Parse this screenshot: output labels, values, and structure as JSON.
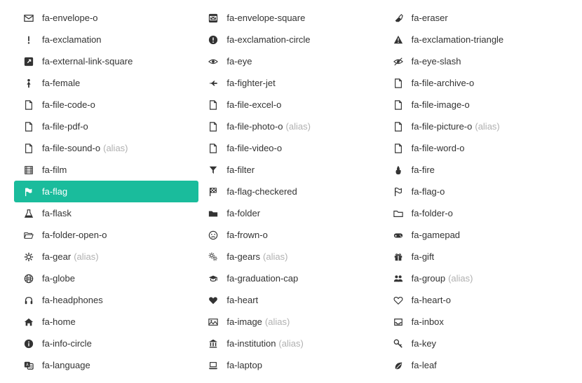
{
  "alias_text": "(alias)",
  "items": [
    {
      "name": "fa-envelope-o",
      "icon": "envelope-o",
      "alias": false,
      "active": false
    },
    {
      "name": "fa-envelope-square",
      "icon": "envelope-square",
      "alias": false,
      "active": false
    },
    {
      "name": "fa-eraser",
      "icon": "eraser",
      "alias": false,
      "active": false
    },
    {
      "name": "fa-exclamation",
      "icon": "exclamation",
      "alias": false,
      "active": false
    },
    {
      "name": "fa-exclamation-circle",
      "icon": "exclamation-circle",
      "alias": false,
      "active": false
    },
    {
      "name": "fa-exclamation-triangle",
      "icon": "exclamation-triangle",
      "alias": false,
      "active": false
    },
    {
      "name": "fa-external-link-square",
      "icon": "external-link-square",
      "alias": false,
      "active": false
    },
    {
      "name": "fa-eye",
      "icon": "eye",
      "alias": false,
      "active": false
    },
    {
      "name": "fa-eye-slash",
      "icon": "eye-slash",
      "alias": false,
      "active": false
    },
    {
      "name": "fa-female",
      "icon": "female",
      "alias": false,
      "active": false
    },
    {
      "name": "fa-fighter-jet",
      "icon": "fighter-jet",
      "alias": false,
      "active": false
    },
    {
      "name": "fa-file-archive-o",
      "icon": "file-archive-o",
      "alias": false,
      "active": false
    },
    {
      "name": "fa-file-code-o",
      "icon": "file-code-o",
      "alias": false,
      "active": false
    },
    {
      "name": "fa-file-excel-o",
      "icon": "file-excel-o",
      "alias": false,
      "active": false
    },
    {
      "name": "fa-file-image-o",
      "icon": "file-image-o",
      "alias": false,
      "active": false
    },
    {
      "name": "fa-file-pdf-o",
      "icon": "file-pdf-o",
      "alias": false,
      "active": false
    },
    {
      "name": "fa-file-photo-o",
      "icon": "file-photo-o",
      "alias": true,
      "active": false
    },
    {
      "name": "fa-file-picture-o",
      "icon": "file-picture-o",
      "alias": true,
      "active": false
    },
    {
      "name": "fa-file-sound-o",
      "icon": "file-sound-o",
      "alias": true,
      "active": false
    },
    {
      "name": "fa-file-video-o",
      "icon": "file-video-o",
      "alias": false,
      "active": false
    },
    {
      "name": "fa-file-word-o",
      "icon": "file-word-o",
      "alias": false,
      "active": false
    },
    {
      "name": "fa-film",
      "icon": "film",
      "alias": false,
      "active": false
    },
    {
      "name": "fa-filter",
      "icon": "filter",
      "alias": false,
      "active": false
    },
    {
      "name": "fa-fire",
      "icon": "fire",
      "alias": false,
      "active": false
    },
    {
      "name": "fa-flag",
      "icon": "flag",
      "alias": false,
      "active": true
    },
    {
      "name": "fa-flag-checkered",
      "icon": "flag-checkered",
      "alias": false,
      "active": false
    },
    {
      "name": "fa-flag-o",
      "icon": "flag-o",
      "alias": false,
      "active": false
    },
    {
      "name": "fa-flask",
      "icon": "flask",
      "alias": false,
      "active": false
    },
    {
      "name": "fa-folder",
      "icon": "folder",
      "alias": false,
      "active": false
    },
    {
      "name": "fa-folder-o",
      "icon": "folder-o",
      "alias": false,
      "active": false
    },
    {
      "name": "fa-folder-open-o",
      "icon": "folder-open-o",
      "alias": false,
      "active": false
    },
    {
      "name": "fa-frown-o",
      "icon": "frown-o",
      "alias": false,
      "active": false
    },
    {
      "name": "fa-gamepad",
      "icon": "gamepad",
      "alias": false,
      "active": false
    },
    {
      "name": "fa-gear",
      "icon": "gear",
      "alias": true,
      "active": false
    },
    {
      "name": "fa-gears",
      "icon": "gears",
      "alias": true,
      "active": false
    },
    {
      "name": "fa-gift",
      "icon": "gift",
      "alias": false,
      "active": false
    },
    {
      "name": "fa-globe",
      "icon": "globe",
      "alias": false,
      "active": false
    },
    {
      "name": "fa-graduation-cap",
      "icon": "graduation-cap",
      "alias": false,
      "active": false
    },
    {
      "name": "fa-group",
      "icon": "group",
      "alias": true,
      "active": false
    },
    {
      "name": "fa-headphones",
      "icon": "headphones",
      "alias": false,
      "active": false
    },
    {
      "name": "fa-heart",
      "icon": "heart",
      "alias": false,
      "active": false
    },
    {
      "name": "fa-heart-o",
      "icon": "heart-o",
      "alias": false,
      "active": false
    },
    {
      "name": "fa-home",
      "icon": "home",
      "alias": false,
      "active": false
    },
    {
      "name": "fa-image",
      "icon": "image",
      "alias": true,
      "active": false
    },
    {
      "name": "fa-inbox",
      "icon": "inbox",
      "alias": false,
      "active": false
    },
    {
      "name": "fa-info-circle",
      "icon": "info-circle",
      "alias": false,
      "active": false
    },
    {
      "name": "fa-institution",
      "icon": "institution",
      "alias": true,
      "active": false
    },
    {
      "name": "fa-key",
      "icon": "key",
      "alias": false,
      "active": false
    },
    {
      "name": "fa-language",
      "icon": "language",
      "alias": false,
      "active": false
    },
    {
      "name": "fa-laptop",
      "icon": "laptop",
      "alias": false,
      "active": false
    },
    {
      "name": "fa-leaf",
      "icon": "leaf",
      "alias": false,
      "active": false
    }
  ]
}
